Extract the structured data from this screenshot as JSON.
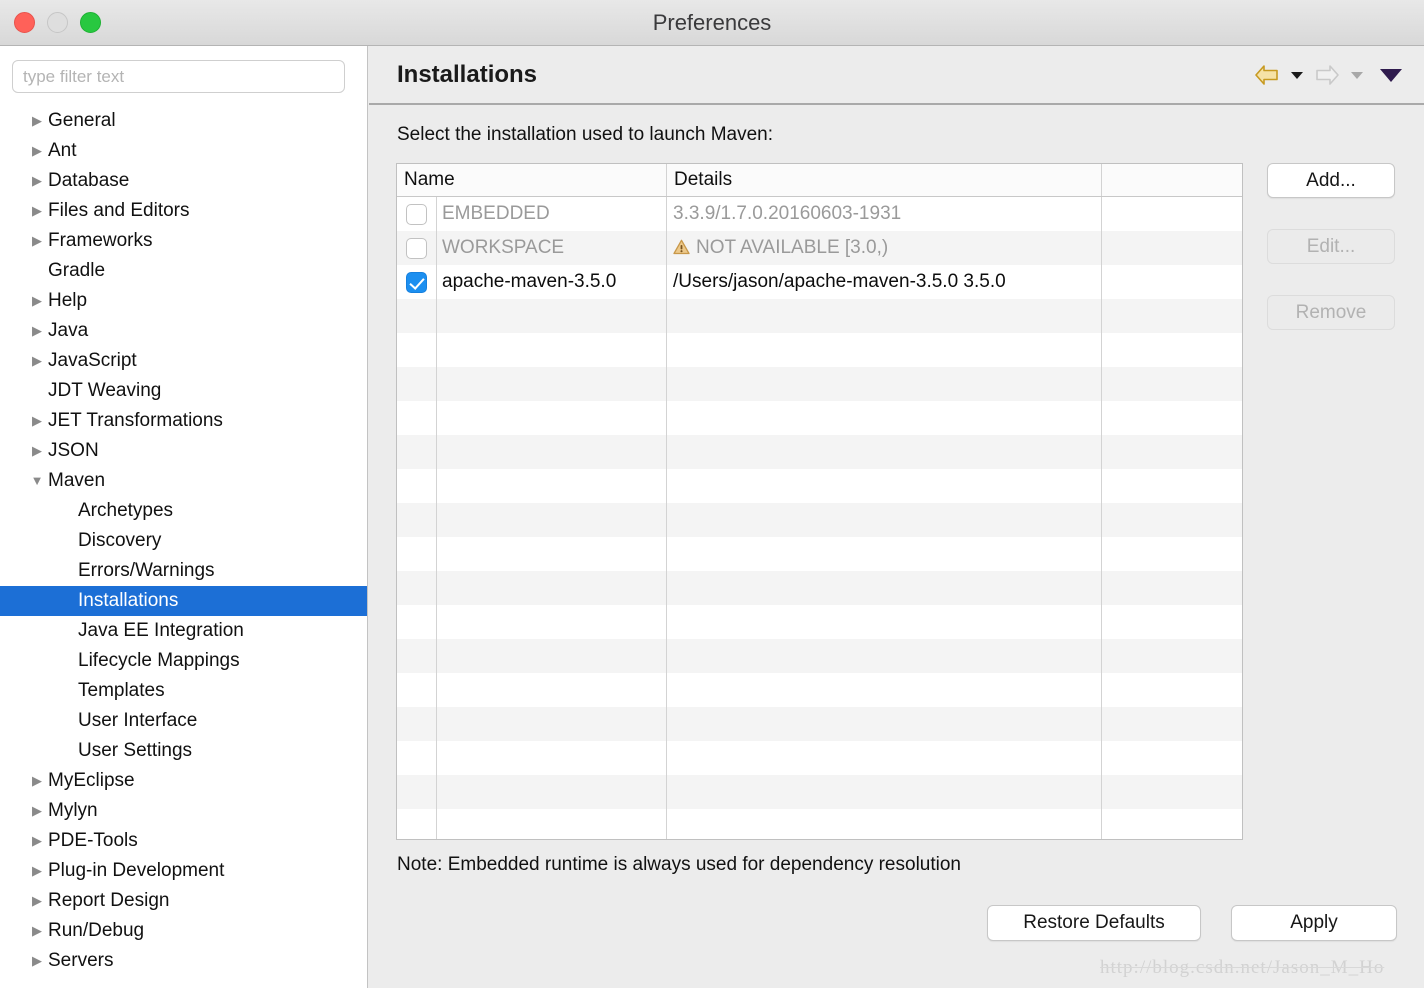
{
  "window": {
    "title": "Preferences",
    "controls": [
      {
        "name": "close",
        "color": "#ff6159"
      },
      {
        "name": "minimize",
        "color": "#dedede"
      },
      {
        "name": "maximize",
        "color": "#28c840"
      }
    ]
  },
  "sidebar": {
    "filter": {
      "value": "",
      "placeholder": "type filter text"
    },
    "items": [
      {
        "label": "General",
        "level": 1,
        "expandable": true,
        "expanded": false,
        "selected": false
      },
      {
        "label": "Ant",
        "level": 1,
        "expandable": true,
        "expanded": false,
        "selected": false
      },
      {
        "label": "Database",
        "level": 1,
        "expandable": true,
        "expanded": false,
        "selected": false
      },
      {
        "label": "Files and Editors",
        "level": 1,
        "expandable": true,
        "expanded": false,
        "selected": false
      },
      {
        "label": "Frameworks",
        "level": 1,
        "expandable": true,
        "expanded": false,
        "selected": false
      },
      {
        "label": "Gradle",
        "level": 1,
        "expandable": false,
        "expanded": false,
        "selected": false
      },
      {
        "label": "Help",
        "level": 1,
        "expandable": true,
        "expanded": false,
        "selected": false
      },
      {
        "label": "Java",
        "level": 1,
        "expandable": true,
        "expanded": false,
        "selected": false
      },
      {
        "label": "JavaScript",
        "level": 1,
        "expandable": true,
        "expanded": false,
        "selected": false
      },
      {
        "label": "JDT Weaving",
        "level": 1,
        "expandable": false,
        "expanded": false,
        "selected": false
      },
      {
        "label": "JET Transformations",
        "level": 1,
        "expandable": true,
        "expanded": false,
        "selected": false
      },
      {
        "label": "JSON",
        "level": 1,
        "expandable": true,
        "expanded": false,
        "selected": false
      },
      {
        "label": "Maven",
        "level": 1,
        "expandable": true,
        "expanded": true,
        "selected": false
      },
      {
        "label": "Archetypes",
        "level": 2,
        "expandable": false,
        "expanded": false,
        "selected": false
      },
      {
        "label": "Discovery",
        "level": 2,
        "expandable": false,
        "expanded": false,
        "selected": false
      },
      {
        "label": "Errors/Warnings",
        "level": 2,
        "expandable": false,
        "expanded": false,
        "selected": false
      },
      {
        "label": "Installations",
        "level": 2,
        "expandable": false,
        "expanded": false,
        "selected": true
      },
      {
        "label": "Java EE Integration",
        "level": 2,
        "expandable": false,
        "expanded": false,
        "selected": false
      },
      {
        "label": "Lifecycle Mappings",
        "level": 2,
        "expandable": false,
        "expanded": false,
        "selected": false
      },
      {
        "label": "Templates",
        "level": 2,
        "expandable": false,
        "expanded": false,
        "selected": false
      },
      {
        "label": "User Interface",
        "level": 2,
        "expandable": false,
        "expanded": false,
        "selected": false
      },
      {
        "label": "User Settings",
        "level": 2,
        "expandable": false,
        "expanded": false,
        "selected": false
      },
      {
        "label": "MyEclipse",
        "level": 1,
        "expandable": true,
        "expanded": false,
        "selected": false
      },
      {
        "label": "Mylyn",
        "level": 1,
        "expandable": true,
        "expanded": false,
        "selected": false
      },
      {
        "label": "PDE-Tools",
        "level": 1,
        "expandable": true,
        "expanded": false,
        "selected": false
      },
      {
        "label": "Plug-in Development",
        "level": 1,
        "expandable": true,
        "expanded": false,
        "selected": false
      },
      {
        "label": "Report Design",
        "level": 1,
        "expandable": true,
        "expanded": false,
        "selected": false
      },
      {
        "label": "Run/Debug",
        "level": 1,
        "expandable": true,
        "expanded": false,
        "selected": false
      },
      {
        "label": "Servers",
        "level": 1,
        "expandable": true,
        "expanded": false,
        "selected": false
      }
    ],
    "selection_color": "#1c6fd6"
  },
  "page": {
    "title": "Installations",
    "instruction": "Select the installation used to launch Maven:",
    "note": "Note: Embedded runtime is always used for dependency resolution",
    "toolbar": [
      {
        "icon": "back-arrow-icon",
        "enabled": true,
        "color": "#f4dfa0"
      },
      {
        "icon": "back-dropdown-icon",
        "enabled": true
      },
      {
        "icon": "forward-arrow-icon",
        "enabled": false,
        "color": "#ededed"
      },
      {
        "icon": "forward-dropdown-icon",
        "enabled": false
      },
      {
        "icon": "menu-dropdown-icon",
        "enabled": true,
        "color": "#2f1b4e"
      }
    ]
  },
  "table": {
    "columns": [
      "Name",
      "Details",
      ""
    ],
    "rows": [
      {
        "checked": false,
        "enabled": false,
        "name": "EMBEDDED",
        "details": "3.3.9/1.7.0.20160603-1931",
        "warning": false,
        "extra": ""
      },
      {
        "checked": false,
        "enabled": false,
        "name": "WORKSPACE",
        "details": "NOT AVAILABLE [3.0,)",
        "warning": true,
        "extra": ""
      },
      {
        "checked": true,
        "enabled": true,
        "name": "apache-maven-3.5.0",
        "details": "/Users/jason/apache-maven-3.5.0 3.5.0",
        "warning": false,
        "extra": ""
      }
    ],
    "empty_row_count": 16,
    "checked_color": "#1c8ff0",
    "warning_color": "#e3a44b"
  },
  "side_buttons": [
    {
      "label": "Add...",
      "enabled": true
    },
    {
      "label": "Edit...",
      "enabled": false
    },
    {
      "label": "Remove",
      "enabled": false
    }
  ],
  "footer_buttons": [
    {
      "label": "Restore Defaults",
      "enabled": true
    },
    {
      "label": "Apply",
      "enabled": true
    }
  ],
  "watermark": "http://blog.csdn.net/Jason_M_Ho"
}
